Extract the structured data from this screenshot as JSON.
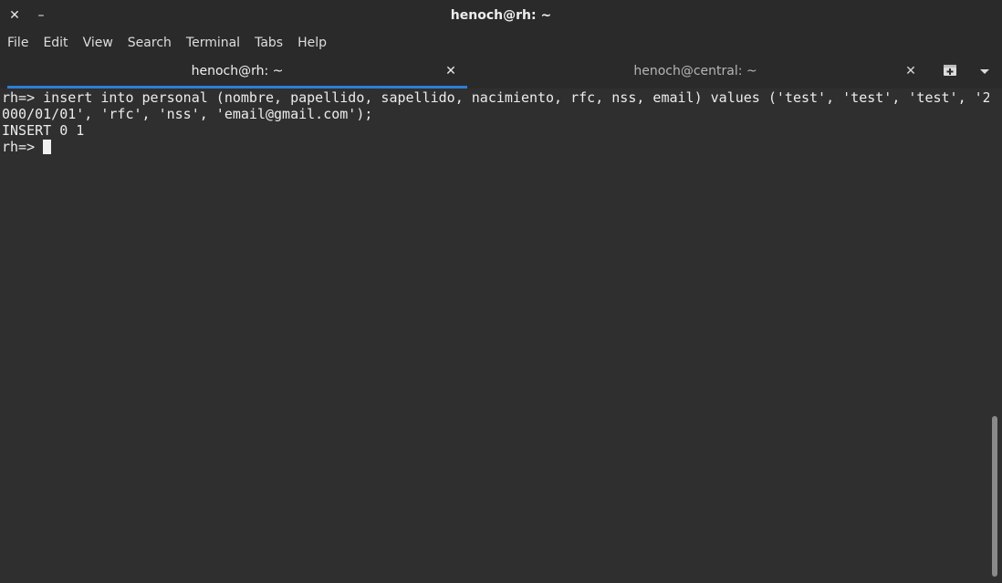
{
  "window": {
    "title": "henoch@rh: ~",
    "close_glyph": "✕",
    "minimize_glyph": "–"
  },
  "menu": [
    "File",
    "Edit",
    "View",
    "Search",
    "Terminal",
    "Tabs",
    "Help"
  ],
  "tabs": [
    {
      "label": "henoch@rh: ~",
      "active": true,
      "close_glyph": "✕"
    },
    {
      "label": "henoch@central: ~",
      "active": false,
      "close_glyph": "✕"
    }
  ],
  "tab_actions": {
    "new_tab_icon": "new-tab-icon",
    "tabs_menu_icon": "chevron-down-icon"
  },
  "terminal": {
    "lines": [
      "rh=> insert into personal (nombre, papellido, sapellido, nacimiento, rfc, nss, email) values ('test', 'test', 'test', '2",
      "000/01/01', 'rfc', 'nss', 'email@gmail.com');",
      "INSERT 0 1",
      "rh=> "
    ]
  },
  "colors": {
    "accent": "#2d7fd6",
    "background": "#2f2f2f",
    "text": "#ececec"
  }
}
